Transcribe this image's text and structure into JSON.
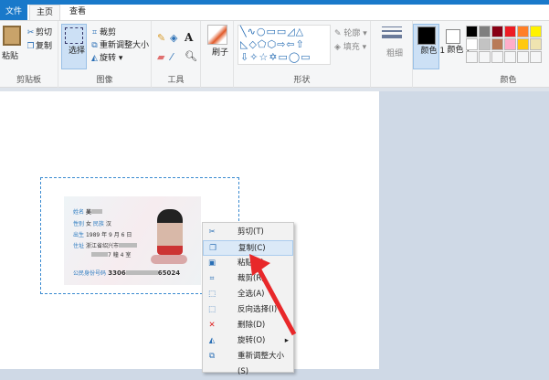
{
  "tabs": {
    "file": "文件",
    "home": "主页",
    "view": "查看"
  },
  "clipboard": {
    "paste": "粘贴",
    "cut": "剪切",
    "copy": "复制",
    "label": "剪贴板"
  },
  "image": {
    "select": "选择",
    "crop": "裁剪",
    "resize": "重新调整大小",
    "rotate": "旋转",
    "label": "图像"
  },
  "tools": {
    "label": "工具"
  },
  "brushes": {
    "label": "刷子"
  },
  "shapes": {
    "outline": "轮廓",
    "fill": "填充",
    "label": "形状"
  },
  "size": {
    "label": "粗细"
  },
  "colors": {
    "color1": "颜色 1",
    "color2": "颜色 2",
    "label": "颜色",
    "color1_value": "#000000",
    "color2_value": "#ffffff",
    "palette": [
      "#000000",
      "#7f7f7f",
      "#880015",
      "#ed1c24",
      "#ff7f27",
      "#fff200",
      "#ffffff",
      "#c3c3c3",
      "#b97a57",
      "#ffaec9",
      "#ffc90e",
      "#efe4b0"
    ]
  },
  "idcard": {
    "name_label": "姓名",
    "name": "吴",
    "sex_label": "性别",
    "sex": "女",
    "ethnic_label": "民族",
    "ethnic": "汉",
    "birth_label": "出生",
    "birth": "1989 年 9 月 6 日",
    "addr_label": "住址",
    "addr1": "浙江省绍兴市",
    "addr2": "7 幢    4 室",
    "id_label": "公民身份号码",
    "id_start": "3306",
    "id_end": "65024"
  },
  "context_menu": [
    {
      "label": "剪切(T)",
      "icon": "scissors-icon"
    },
    {
      "label": "复制(C)",
      "icon": "copy-icon",
      "highlighted": true
    },
    {
      "label": "粘贴(P)",
      "icon": "paste-icon"
    },
    {
      "label": "裁剪(R)",
      "icon": "crop-icon"
    },
    {
      "label": "全选(A)",
      "icon": "select-all-icon"
    },
    {
      "label": "反向选择(I)",
      "icon": "invert-selection-icon"
    },
    {
      "label": "删除(D)",
      "icon": "delete-icon"
    },
    {
      "label": "旋转(O)",
      "icon": "rotate-icon",
      "submenu": true
    },
    {
      "label": "重新调整大小(S)",
      "icon": "resize-icon"
    }
  ]
}
